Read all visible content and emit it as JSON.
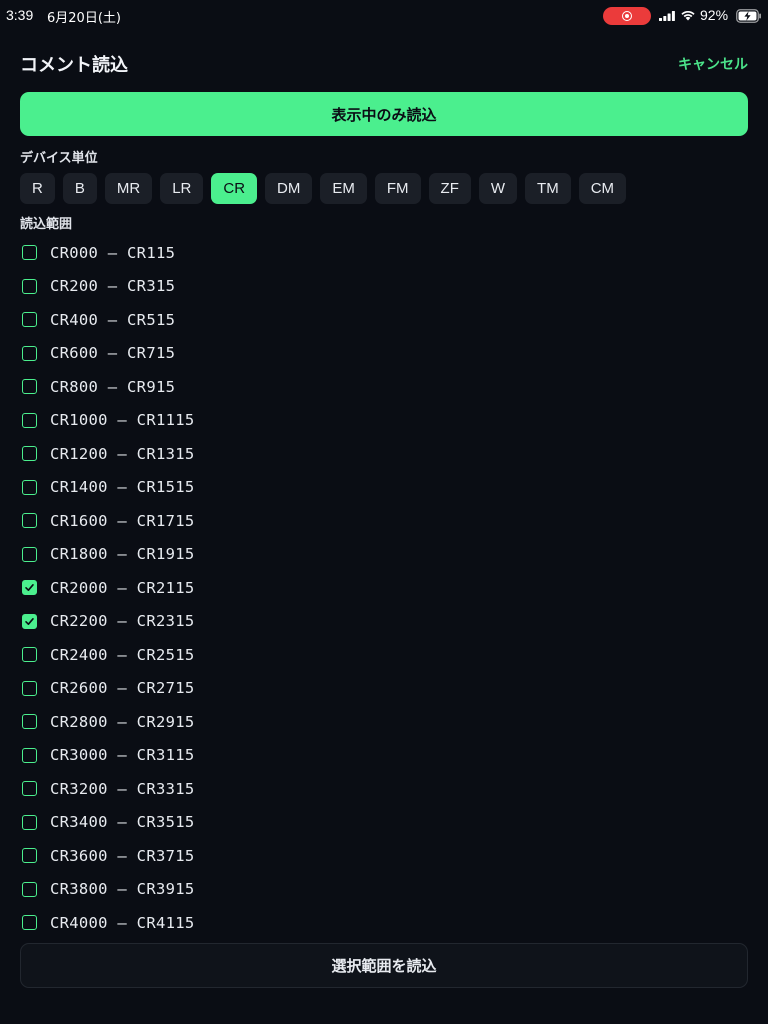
{
  "status_bar": {
    "time": "3:39",
    "date": "6月20日(土)",
    "battery_percent": "92%",
    "record_color": "#eb3b3b"
  },
  "header": {
    "title": "コメント読込",
    "cancel_label": "キャンセル"
  },
  "primary_button_label": "表示中のみ読込",
  "device_section": {
    "label": "デバイス単位",
    "selected": "CR",
    "items": [
      {
        "label": "R",
        "active": false
      },
      {
        "label": "B",
        "active": false
      },
      {
        "label": "MR",
        "active": false
      },
      {
        "label": "LR",
        "active": false
      },
      {
        "label": "CR",
        "active": true
      },
      {
        "label": "DM",
        "active": false
      },
      {
        "label": "EM",
        "active": false
      },
      {
        "label": "FM",
        "active": false
      },
      {
        "label": "ZF",
        "active": false
      },
      {
        "label": "W",
        "active": false
      },
      {
        "label": "TM",
        "active": false
      },
      {
        "label": "CM",
        "active": false
      }
    ]
  },
  "range_section": {
    "label": "読込範囲",
    "items": [
      {
        "label": "CR000 – CR115",
        "checked": false
      },
      {
        "label": "CR200 – CR315",
        "checked": false
      },
      {
        "label": "CR400 – CR515",
        "checked": false
      },
      {
        "label": "CR600 – CR715",
        "checked": false
      },
      {
        "label": "CR800 – CR915",
        "checked": false
      },
      {
        "label": "CR1000 – CR1115",
        "checked": false
      },
      {
        "label": "CR1200 – CR1315",
        "checked": false
      },
      {
        "label": "CR1400 – CR1515",
        "checked": false
      },
      {
        "label": "CR1600 – CR1715",
        "checked": false
      },
      {
        "label": "CR1800 – CR1915",
        "checked": false
      },
      {
        "label": "CR2000 – CR2115",
        "checked": true
      },
      {
        "label": "CR2200 – CR2315",
        "checked": true
      },
      {
        "label": "CR2400 – CR2515",
        "checked": false
      },
      {
        "label": "CR2600 – CR2715",
        "checked": false
      },
      {
        "label": "CR2800 – CR2915",
        "checked": false
      },
      {
        "label": "CR3000 – CR3115",
        "checked": false
      },
      {
        "label": "CR3200 – CR3315",
        "checked": false
      },
      {
        "label": "CR3400 – CR3515",
        "checked": false
      },
      {
        "label": "CR3600 – CR3715",
        "checked": false
      },
      {
        "label": "CR3800 – CR3915",
        "checked": false
      },
      {
        "label": "CR4000 – CR4115",
        "checked": false
      }
    ]
  },
  "bottom_button_label": "選択範囲を読込",
  "colors": {
    "accent": "#4bef8e",
    "background": "#0a0d14",
    "chip": "#1b1f27"
  }
}
